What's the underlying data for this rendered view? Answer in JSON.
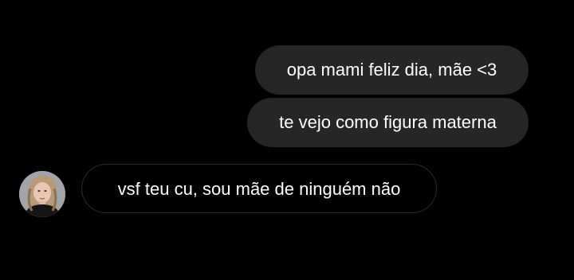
{
  "conversation": {
    "messages": [
      {
        "sender": "me",
        "text": "opa mami feliz dia, mãe <3"
      },
      {
        "sender": "me",
        "text": "te vejo como figura materna"
      },
      {
        "sender": "contact",
        "text": "vsf teu cu, sou mãe de ninguém não"
      }
    ]
  },
  "colors": {
    "background": "#000000",
    "sent_bubble": "#262626",
    "received_bubble_border": "#2b2b2b",
    "text": "#ffffff"
  },
  "icons": {
    "contact_avatar": "contact-avatar-photo"
  }
}
